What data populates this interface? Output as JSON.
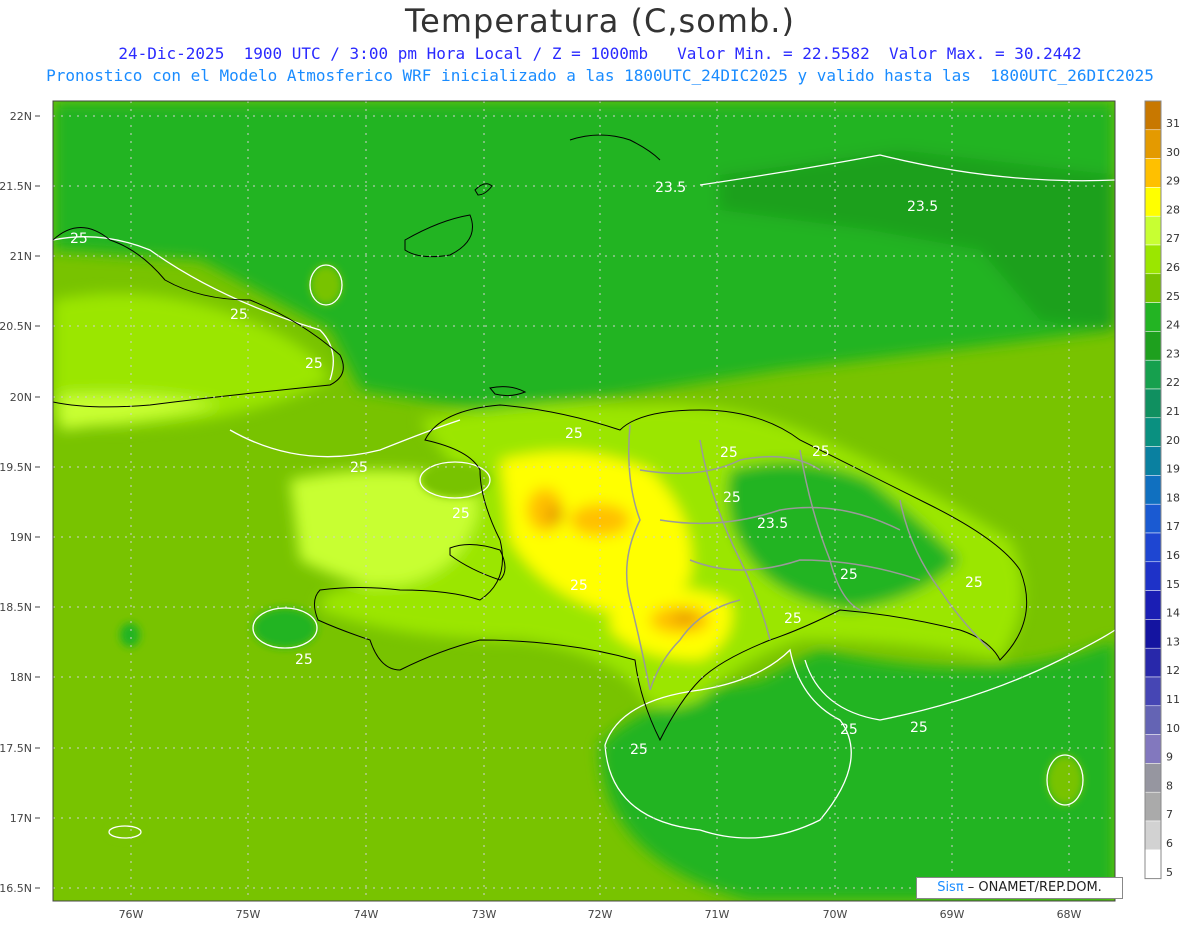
{
  "header": {
    "title": "Temperatura (C,somb.)",
    "line1": "24-Dic-2025  1900 UTC / 3:00 pm Hora Local / Z = 1000mb   Valor Min. = 22.5582  Valor Max. = 30.2442",
    "line2": "Pronostico con el Modelo Atmosferico WRF inicializado a las 1800UTC_24DIC2025 y valido hasta las  1800UTC_26DIC2025"
  },
  "axes": {
    "lat_labels": [
      "22N",
      "21.5N",
      "21N",
      "20.5N",
      "20N",
      "19.5N",
      "19N",
      "18.5N",
      "18N",
      "17.5N",
      "17N",
      "16.5N"
    ],
    "lon_labels": [
      "76W",
      "75W",
      "74W",
      "73W",
      "72W",
      "71W",
      "70W",
      "69W",
      "68W"
    ]
  },
  "colorbar": {
    "labels": [
      "31",
      "30",
      "29",
      "28",
      "27",
      "26",
      "25",
      "24",
      "23",
      "22",
      "21",
      "20",
      "19",
      "18",
      "17",
      "16",
      "15",
      "14",
      "13",
      "12",
      "11",
      "10",
      "9",
      "8",
      "7",
      "6",
      "5"
    ],
    "colors": [
      "#c87800",
      "#e49a00",
      "#ffc000",
      "#ffff00",
      "#c8ff32",
      "#9be600",
      "#78c300",
      "#23b423",
      "#1ea01e",
      "#16a04e",
      "#109060",
      "#0a9080",
      "#0a80a0",
      "#1070c0",
      "#1a5ad2",
      "#1e46d2",
      "#1e32c8",
      "#1a1eb4",
      "#1414a0",
      "#2828aa",
      "#4646b4",
      "#6464b4",
      "#8278be",
      "#9696a0",
      "#aaaaaa",
      "#d2d2d2",
      "#ffffff"
    ]
  },
  "contour_labels": [
    {
      "text": "25"
    },
    {
      "text": "23.5"
    },
    {
      "text": "23.5"
    },
    {
      "text": "25"
    },
    {
      "text": "25"
    },
    {
      "text": "25"
    },
    {
      "text": "25"
    },
    {
      "text": "25"
    },
    {
      "text": "25"
    },
    {
      "text": "25"
    },
    {
      "text": "23.5"
    },
    {
      "text": "25"
    },
    {
      "text": "25"
    },
    {
      "text": "25"
    },
    {
      "text": "25"
    },
    {
      "text": "25"
    },
    {
      "text": "25"
    },
    {
      "text": "25"
    },
    {
      "text": "25"
    },
    {
      "text": "25"
    }
  ],
  "credit": {
    "brand": "Sisπ",
    "text": " – ONAMET/REP.DOM."
  }
}
